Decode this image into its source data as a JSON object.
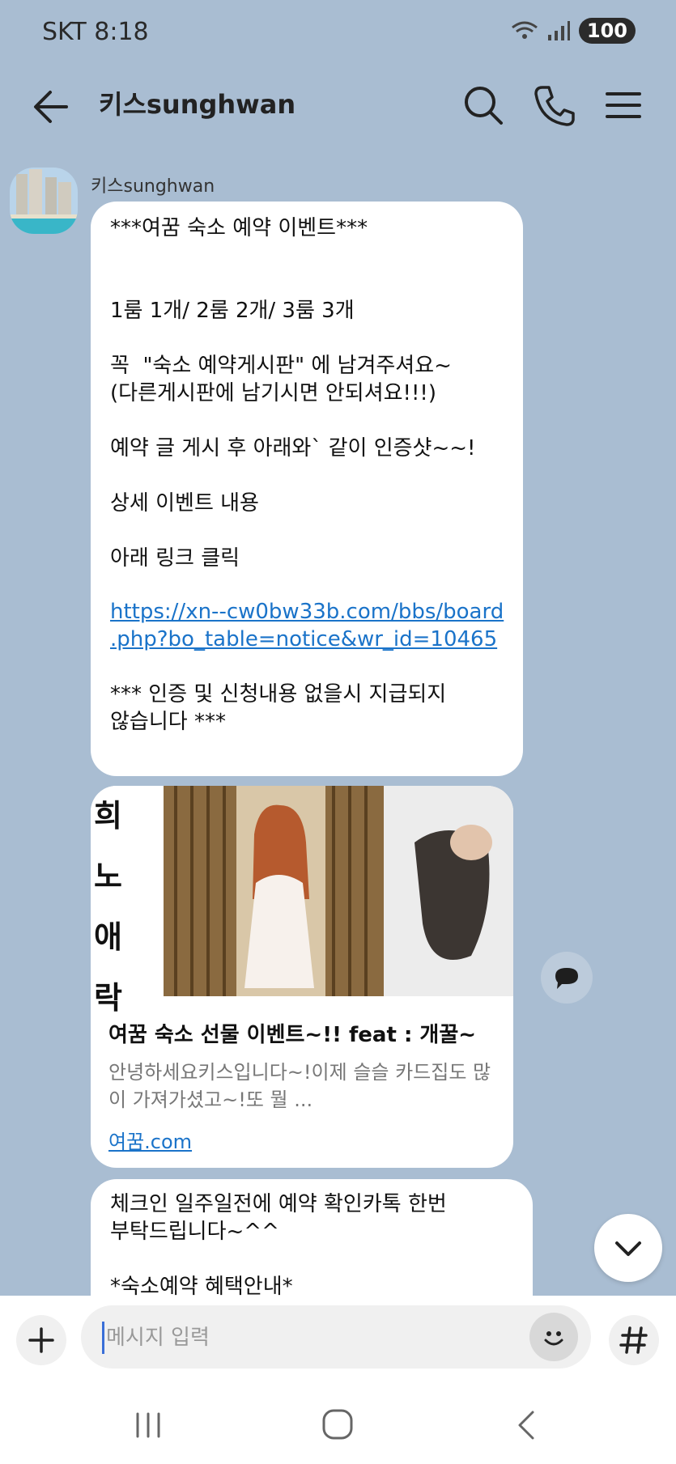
{
  "status_bar": {
    "carrier_time": "SKT 8:18",
    "battery": "100",
    "icons": [
      "wifi-icon",
      "signal-icon",
      "battery-icon"
    ]
  },
  "header": {
    "title": "키스sunghwan",
    "icons": [
      "back-arrow-icon",
      "search-icon",
      "phone-icon",
      "menu-icon"
    ]
  },
  "messages": {
    "sender": "키스sunghwan",
    "msg1": {
      "l1": "***여꿈 숙소 예약 이벤트***",
      "l2": "1룸 1개/ 2룸 2개/ 3룸 3개",
      "l3": "꼭  \"숙소 예약게시판\" 에 남겨주셔요~",
      "l4": "(다른게시판에 남기시면 안되셔요!!!)",
      "l5": "예약 글 게시 후 아래와` 같이 인증샷~~!",
      "l6": "상세 이벤트 내용",
      "l7": "아래 링크 클릭",
      "link": "https://xn--cw0bw33b.com/bbs/board\n.php?bo_table=notice&wr_id=10465",
      "l8": "*** 인증 및 신청내용 없을시 지급되지\n않습니다 ***"
    },
    "card": {
      "image_text": [
        "희",
        "노",
        "애",
        "락"
      ],
      "title": "여꿈 숙소 선물 이벤트~!! feat : 개꿀~",
      "desc": "안녕하세요키스입니다~!이제 슬슬 카드집도 많이 가져가셨고~!또 뭘 ...",
      "link": "여꿈.com"
    },
    "msg3": {
      "l1": "체크인 일주일전에 예약 확인카톡 한번",
      "l2": "부탁드립니다~^^",
      "l3": "*숙소예약 혜택안내*"
    }
  },
  "input": {
    "placeholder": "메시지 입력",
    "value": ""
  },
  "colors": {
    "background": "#a9bdd2",
    "link": "#1a73c9",
    "bubble": "#ffffff"
  }
}
